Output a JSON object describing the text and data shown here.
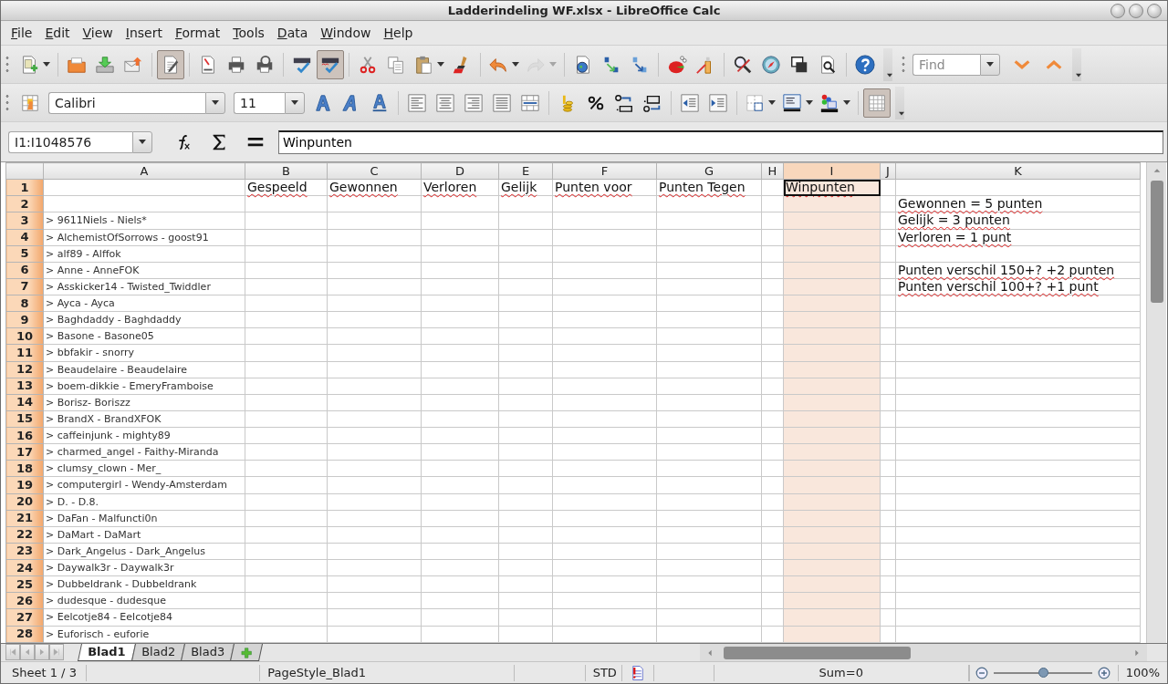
{
  "window": {
    "title": "Ladderindeling WF.xlsx - LibreOffice Calc"
  },
  "menu": [
    "File",
    "Edit",
    "View",
    "Insert",
    "Format",
    "Tools",
    "Data",
    "Window",
    "Help"
  ],
  "standard_toolbar": [
    {
      "kind": "new",
      "pressed": false,
      "disabled": false,
      "dropdown": true
    },
    {
      "kind": "separator"
    },
    {
      "kind": "open",
      "pressed": false,
      "disabled": false,
      "dropdown": false
    },
    {
      "kind": "save",
      "pressed": false,
      "disabled": false,
      "dropdown": false
    },
    {
      "kind": "email",
      "pressed": false,
      "disabled": false,
      "dropdown": false
    },
    {
      "kind": "separator"
    },
    {
      "kind": "edit",
      "pressed": true,
      "disabled": false,
      "dropdown": false
    },
    {
      "kind": "separator"
    },
    {
      "kind": "pdf",
      "pressed": false,
      "disabled": false,
      "dropdown": false
    },
    {
      "kind": "print",
      "pressed": false,
      "disabled": false,
      "dropdown": false
    },
    {
      "kind": "preview",
      "pressed": false,
      "disabled": false,
      "dropdown": false
    },
    {
      "kind": "separator"
    },
    {
      "kind": "spell",
      "pressed": false,
      "disabled": false,
      "dropdown": false
    },
    {
      "kind": "autospell",
      "pressed": true,
      "disabled": false,
      "dropdown": false
    },
    {
      "kind": "separator"
    },
    {
      "kind": "cut",
      "pressed": false,
      "disabled": false,
      "dropdown": false
    },
    {
      "kind": "copy",
      "pressed": false,
      "disabled": false,
      "dropdown": false
    },
    {
      "kind": "paste",
      "pressed": false,
      "disabled": false,
      "dropdown": true
    },
    {
      "kind": "brush",
      "pressed": false,
      "disabled": false,
      "dropdown": false
    },
    {
      "kind": "separator"
    },
    {
      "kind": "undo",
      "pressed": false,
      "disabled": false,
      "dropdown": true
    },
    {
      "kind": "redo",
      "pressed": false,
      "disabled": true,
      "dropdown": true
    },
    {
      "kind": "separator"
    },
    {
      "kind": "hyperlink",
      "pressed": false,
      "disabled": false,
      "dropdown": false
    },
    {
      "kind": "sortasc",
      "pressed": false,
      "disabled": false,
      "dropdown": false
    },
    {
      "kind": "sortdesc",
      "pressed": false,
      "disabled": false,
      "dropdown": false
    },
    {
      "kind": "separator"
    },
    {
      "kind": "chart",
      "pressed": false,
      "disabled": false,
      "dropdown": false
    },
    {
      "kind": "draw",
      "pressed": false,
      "disabled": false,
      "dropdown": false
    },
    {
      "kind": "separator"
    },
    {
      "kind": "findreplace",
      "pressed": false,
      "disabled": false,
      "dropdown": false
    },
    {
      "kind": "navigator",
      "pressed": false,
      "disabled": false,
      "dropdown": false
    },
    {
      "kind": "gallery",
      "pressed": false,
      "disabled": false,
      "dropdown": false
    },
    {
      "kind": "zoom",
      "pressed": false,
      "disabled": false,
      "dropdown": false
    },
    {
      "kind": "separator"
    },
    {
      "kind": "help",
      "pressed": false,
      "disabled": false,
      "dropdown": false
    }
  ],
  "find_toolbar": {
    "placeholder": "Find"
  },
  "formatting_toolbar": [
    {
      "kind": "styles",
      "pressed": false,
      "disabled": false,
      "dropdown": false
    },
    {
      "kind": "font-name",
      "value": "Calibri"
    },
    {
      "kind": "font-size",
      "value": "11"
    },
    {
      "kind": "bold",
      "pressed": false,
      "disabled": false,
      "dropdown": false
    },
    {
      "kind": "italic",
      "pressed": false,
      "disabled": false,
      "dropdown": false
    },
    {
      "kind": "underline",
      "pressed": false,
      "disabled": false,
      "dropdown": false
    },
    {
      "kind": "separator"
    },
    {
      "kind": "alignleft",
      "pressed": false,
      "disabled": false,
      "dropdown": false
    },
    {
      "kind": "aligncenter",
      "pressed": false,
      "disabled": false,
      "dropdown": false
    },
    {
      "kind": "alignright",
      "pressed": false,
      "disabled": false,
      "dropdown": false
    },
    {
      "kind": "justify",
      "pressed": false,
      "disabled": false,
      "dropdown": false
    },
    {
      "kind": "merge",
      "pressed": false,
      "disabled": false,
      "dropdown": false
    },
    {
      "kind": "separator"
    },
    {
      "kind": "currency",
      "pressed": false,
      "disabled": false,
      "dropdown": false
    },
    {
      "kind": "percent",
      "pressed": false,
      "disabled": false,
      "dropdown": false
    },
    {
      "kind": "adddec",
      "pressed": false,
      "disabled": false,
      "dropdown": false
    },
    {
      "kind": "deldec",
      "pressed": false,
      "disabled": false,
      "dropdown": false
    },
    {
      "kind": "separator"
    },
    {
      "kind": "indentdec",
      "pressed": false,
      "disabled": false,
      "dropdown": false
    },
    {
      "kind": "indentinc",
      "pressed": false,
      "disabled": false,
      "dropdown": false
    },
    {
      "kind": "separator"
    },
    {
      "kind": "borders",
      "pressed": false,
      "disabled": false,
      "dropdown": true
    },
    {
      "kind": "borderstyle",
      "pressed": false,
      "disabled": false,
      "dropdown": true
    },
    {
      "kind": "colors",
      "pressed": false,
      "disabled": false,
      "dropdown": true
    },
    {
      "kind": "separator"
    },
    {
      "kind": "grid",
      "pressed": true,
      "disabled": false,
      "dropdown": false
    }
  ],
  "formula_bar": {
    "name_box": "I1:I1048576",
    "formula": "Winpunten"
  },
  "sheet": {
    "columns": [
      {
        "label": "A",
        "selected": false
      },
      {
        "label": "B",
        "selected": false
      },
      {
        "label": "C",
        "selected": false
      },
      {
        "label": "D",
        "selected": false
      },
      {
        "label": "E",
        "selected": false
      },
      {
        "label": "F",
        "selected": false
      },
      {
        "label": "G",
        "selected": false
      },
      {
        "label": "H",
        "selected": false
      },
      {
        "label": "I",
        "selected": true
      },
      {
        "label": "J",
        "selected": false
      },
      {
        "label": "K",
        "selected": false
      }
    ],
    "rows": [
      {
        "number": "1",
        "selected": true,
        "cells": [
          null,
          "Gespeeld",
          "Gewonnen",
          "Verloren",
          "Gelijk",
          "Punten voor",
          "Punten Tegen",
          null,
          {
            "text": "Winpunten",
            "active": true
          },
          null,
          null
        ]
      },
      {
        "number": "2",
        "selected": true,
        "cells": [
          null,
          null,
          null,
          null,
          null,
          null,
          null,
          null,
          null,
          null,
          "Gewonnen = 5 punten"
        ]
      },
      {
        "number": "3",
        "selected": true,
        "cells": [
          "> 9611Niels - Niels*",
          null,
          null,
          null,
          null,
          null,
          null,
          null,
          null,
          null,
          "Gelijk = 3 punten"
        ]
      },
      {
        "number": "4",
        "selected": true,
        "cells": [
          "> AlchemistOfSorrows - goost91",
          null,
          null,
          null,
          null,
          null,
          null,
          null,
          null,
          null,
          "Verloren = 1 punt"
        ]
      },
      {
        "number": "5",
        "selected": true,
        "cells": [
          "> alf89 - Alffok"
        ]
      },
      {
        "number": "6",
        "selected": true,
        "cells": [
          "> Anne - AnneFOK",
          null,
          null,
          null,
          null,
          null,
          null,
          null,
          null,
          null,
          "Punten verschil 150+? +2 punten"
        ]
      },
      {
        "number": "7",
        "selected": true,
        "cells": [
          "> Asskicker14 - Twisted_Twiddler",
          null,
          null,
          null,
          null,
          null,
          null,
          null,
          null,
          null,
          "Punten verschil 100+? +1 punt"
        ]
      },
      {
        "number": "8",
        "selected": true,
        "cells": [
          "> Ayca - Ayca"
        ]
      },
      {
        "number": "9",
        "selected": true,
        "cells": [
          "> Baghdaddy - Baghdaddy"
        ]
      },
      {
        "number": "10",
        "selected": true,
        "cells": [
          "> Basone - Basone05"
        ]
      },
      {
        "number": "11",
        "selected": true,
        "cells": [
          "> bbfakir - snorry"
        ]
      },
      {
        "number": "12",
        "selected": true,
        "cells": [
          "> Beaudelaire - Beaudelaire"
        ]
      },
      {
        "number": "13",
        "selected": true,
        "cells": [
          "> boem-dikkie - EmeryFramboise"
        ]
      },
      {
        "number": "14",
        "selected": true,
        "cells": [
          "> Borisz- Boriszz"
        ]
      },
      {
        "number": "15",
        "selected": true,
        "cells": [
          "> BrandX - BrandXFOK"
        ]
      },
      {
        "number": "16",
        "selected": true,
        "cells": [
          "> caffeinjunk - mighty89"
        ]
      },
      {
        "number": "17",
        "selected": true,
        "cells": [
          "> charmed_angel - Faithy-Miranda"
        ]
      },
      {
        "number": "18",
        "selected": true,
        "cells": [
          "> clumsy_clown - Mer_"
        ]
      },
      {
        "number": "19",
        "selected": true,
        "cells": [
          "> computergirl - Wendy-Amsterdam"
        ]
      },
      {
        "number": "20",
        "selected": true,
        "cells": [
          "> D. - D.8."
        ]
      },
      {
        "number": "21",
        "selected": true,
        "cells": [
          "> DaFan - Malfuncti0n"
        ]
      },
      {
        "number": "22",
        "selected": true,
        "cells": [
          "> DaMart - DaMart"
        ]
      },
      {
        "number": "23",
        "selected": true,
        "cells": [
          "> Dark_Angelus - Dark_Angelus"
        ]
      },
      {
        "number": "24",
        "selected": true,
        "cells": [
          "> Daywalk3r - Daywalk3r"
        ]
      },
      {
        "number": "25",
        "selected": true,
        "cells": [
          "> Dubbeldrank - Dubbeldrank"
        ]
      },
      {
        "number": "26",
        "selected": true,
        "cells": [
          "> dudesque - dudesque"
        ]
      },
      {
        "number": "27",
        "selected": true,
        "cells": [
          "> Eelcotje84 - Eelcotje84"
        ]
      },
      {
        "number": "28",
        "selected": true,
        "cells": [
          "> Euforisch - euforie"
        ]
      }
    ]
  },
  "sheet_tabs": [
    {
      "label": "Blad1",
      "selected": true
    },
    {
      "label": "Blad2",
      "selected": false
    },
    {
      "label": "Blad3",
      "selected": false
    }
  ],
  "status_bar": {
    "sheet_position": "Sheet 1 / 3",
    "page_style": "PageStyle_Blad1",
    "selection_mode": "STD",
    "sum": "Sum=0",
    "zoom": {
      "level": 0.5,
      "reading": "100%"
    }
  }
}
